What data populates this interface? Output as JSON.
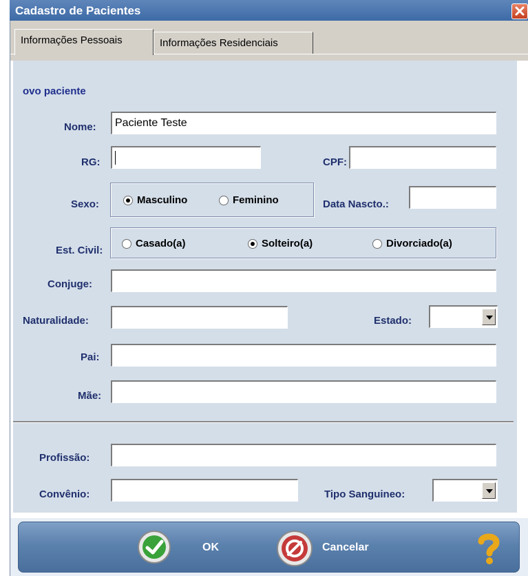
{
  "window": {
    "title": "Cadastro de Pacientes"
  },
  "tabs": [
    {
      "label": "Informações Pessoais",
      "active": true
    },
    {
      "label": "Informações Residenciais",
      "active": false
    }
  ],
  "form": {
    "section_header": "ovo paciente",
    "nome": {
      "label": "Nome:",
      "value": "Paciente Teste"
    },
    "rg": {
      "label": "RG:",
      "value": ""
    },
    "cpf": {
      "label": "CPF:",
      "value": ""
    },
    "sexo": {
      "label": "Sexo:",
      "options": [
        "Masculino",
        "Feminino"
      ],
      "selected": "Masculino"
    },
    "data_nascimento": {
      "label": "Data Nascto.:",
      "value": ""
    },
    "estado_civil": {
      "label": "Est. Civil:",
      "options": [
        "Casado(a)",
        "Solteiro(a)",
        "Divorciado(a)"
      ],
      "selected": "Solteiro(a)"
    },
    "conjuge": {
      "label": "Conjuge:",
      "value": ""
    },
    "naturalidade": {
      "label": "Naturalidade:",
      "value": ""
    },
    "estado": {
      "label": "Estado:",
      "value": ""
    },
    "pai": {
      "label": "Pai:",
      "value": ""
    },
    "mae": {
      "label": "Mãe:",
      "value": ""
    },
    "profissao": {
      "label": "Profissão:",
      "value": ""
    },
    "convenio": {
      "label": "Convênio:",
      "value": ""
    },
    "tipo_sanguineo": {
      "label": "Tipo Sanguineo:",
      "value": ""
    }
  },
  "footer": {
    "ok_label": "OK",
    "cancel_label": "Cancelar"
  },
  "icons": {
    "close": "close-icon",
    "ok": "check-icon",
    "cancel": "cancel-icon",
    "help": "help-icon"
  },
  "colors": {
    "title_bar": "#4a75ae",
    "panel": "#d4dee9",
    "label": "#1f2f6c",
    "footer_bar": "#5b81ad"
  }
}
